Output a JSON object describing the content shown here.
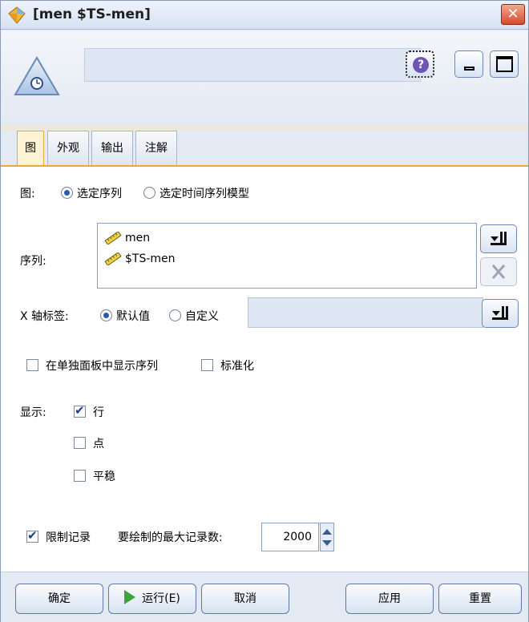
{
  "window": {
    "title": "[men $TS-men]",
    "close_glyph": "✕"
  },
  "header": {
    "node_name": "",
    "help_glyph": "?"
  },
  "tabs": [
    {
      "label": "图",
      "active": true
    },
    {
      "label": "外观",
      "active": false
    },
    {
      "label": "输出",
      "active": false
    },
    {
      "label": "注解",
      "active": false
    }
  ],
  "plot": {
    "label": "图:",
    "option_selected_series": "选定序列",
    "option_selected_model": "选定时间序列模型",
    "selected_option": "选定序列"
  },
  "series": {
    "label": "序列:",
    "items": [
      "men",
      "$TS-men"
    ],
    "picker_icon": "field-picker-icon",
    "remove_icon": "remove-icon"
  },
  "xaxis": {
    "label": "X 轴标签:",
    "option_default": "默认值",
    "option_custom": "自定义",
    "selected_option": "默认值",
    "custom_value": ""
  },
  "panel_options": {
    "separate_panels_label": "在单独面板中显示序列",
    "separate_panels_checked": false,
    "normalize_label": "标准化",
    "normalize_checked": false
  },
  "display": {
    "label": "显示:",
    "line_label": "行",
    "line_checked": true,
    "points_label": "点",
    "points_checked": false,
    "smooth_label": "平稳",
    "smooth_checked": false
  },
  "limit": {
    "label": "限制记录",
    "checked": true,
    "max_label": "要绘制的最大记录数:",
    "max_value": "2000"
  },
  "footer": {
    "ok": "确定",
    "run": "运行(E)",
    "cancel": "取消",
    "apply": "应用",
    "reset": "重置"
  },
  "colors": {
    "accent_tab": "#e6a93b",
    "radio_dot": "#2a58b5",
    "run_icon": "#3aa33a",
    "close_button": "#d9492c"
  }
}
